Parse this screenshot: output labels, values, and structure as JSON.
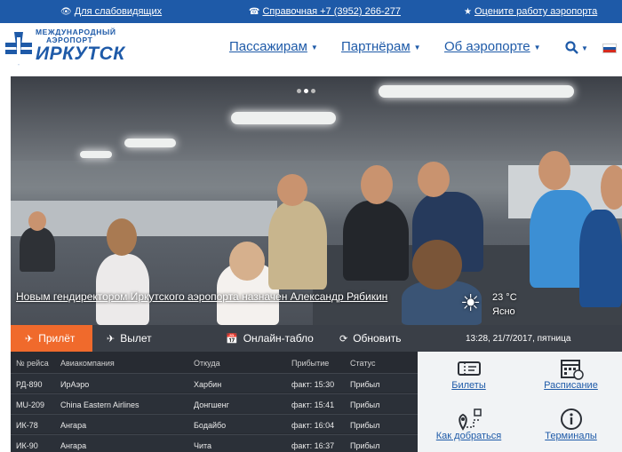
{
  "topbar": {
    "accessibility_label": "Для слабовидящих",
    "helpdesk_label": "Справочная +7 (3952) 266-277",
    "rate_label": "Оцените работу аэропорта"
  },
  "logo": {
    "small_text_line1": "МЕЖДУНАРОДНЫЙ",
    "small_text_line2": "АЭРОПОРТ",
    "big_text": "ИРКУТСК"
  },
  "nav": {
    "items": [
      {
        "label": "Пассажирам"
      },
      {
        "label": "Партнёрам"
      },
      {
        "label": "Об аэропорте"
      }
    ]
  },
  "hero": {
    "news_link": "Новым гендиректором Иркутского аэропорта назначен Александр Рябикин",
    "weather_temp": "23 °С",
    "weather_cond": "Ясно"
  },
  "tabs": {
    "arrival": "Прилёт",
    "departure": "Вылет",
    "online_board": "Онлайн-табло",
    "refresh": "Обновить",
    "timestamp": "13:28, 21/7/2017, пятница"
  },
  "flights": {
    "headers": [
      "№ рейса",
      "Авиакомпания",
      "Откуда",
      "Прибытие",
      "Статус"
    ],
    "rows": [
      [
        "РД-890",
        "ИрАэро",
        "Харбин",
        "факт: 15:30",
        "Прибыл"
      ],
      [
        "MU-209",
        "China Eastern Airlines",
        "Донгшенг",
        "факт: 15:41",
        "Прибыл"
      ],
      [
        "ИК-78",
        "Ангара",
        "Бодайбо",
        "факт: 16:04",
        "Прибыл"
      ],
      [
        "ИК-90",
        "Ангара",
        "Чита",
        "факт: 16:37",
        "Прибыл"
      ]
    ]
  },
  "quicklinks": {
    "tickets": "Билеты",
    "schedule": "Расписание",
    "directions": "Как добраться",
    "terminals": "Терминалы"
  },
  "colors": {
    "brand_blue": "#1e5aa8",
    "accent_orange": "#f06a2c",
    "table_dark": "#272b32"
  },
  "icons": [
    "eye-icon",
    "phone-icon",
    "star-icon",
    "search-icon",
    "flag-ru-icon",
    "plane-landing-icon",
    "plane-takeoff-icon",
    "calendar-icon",
    "refresh-icon",
    "sun-icon",
    "ticket-icon",
    "schedule-icon",
    "map-pin-icon",
    "info-icon"
  ]
}
